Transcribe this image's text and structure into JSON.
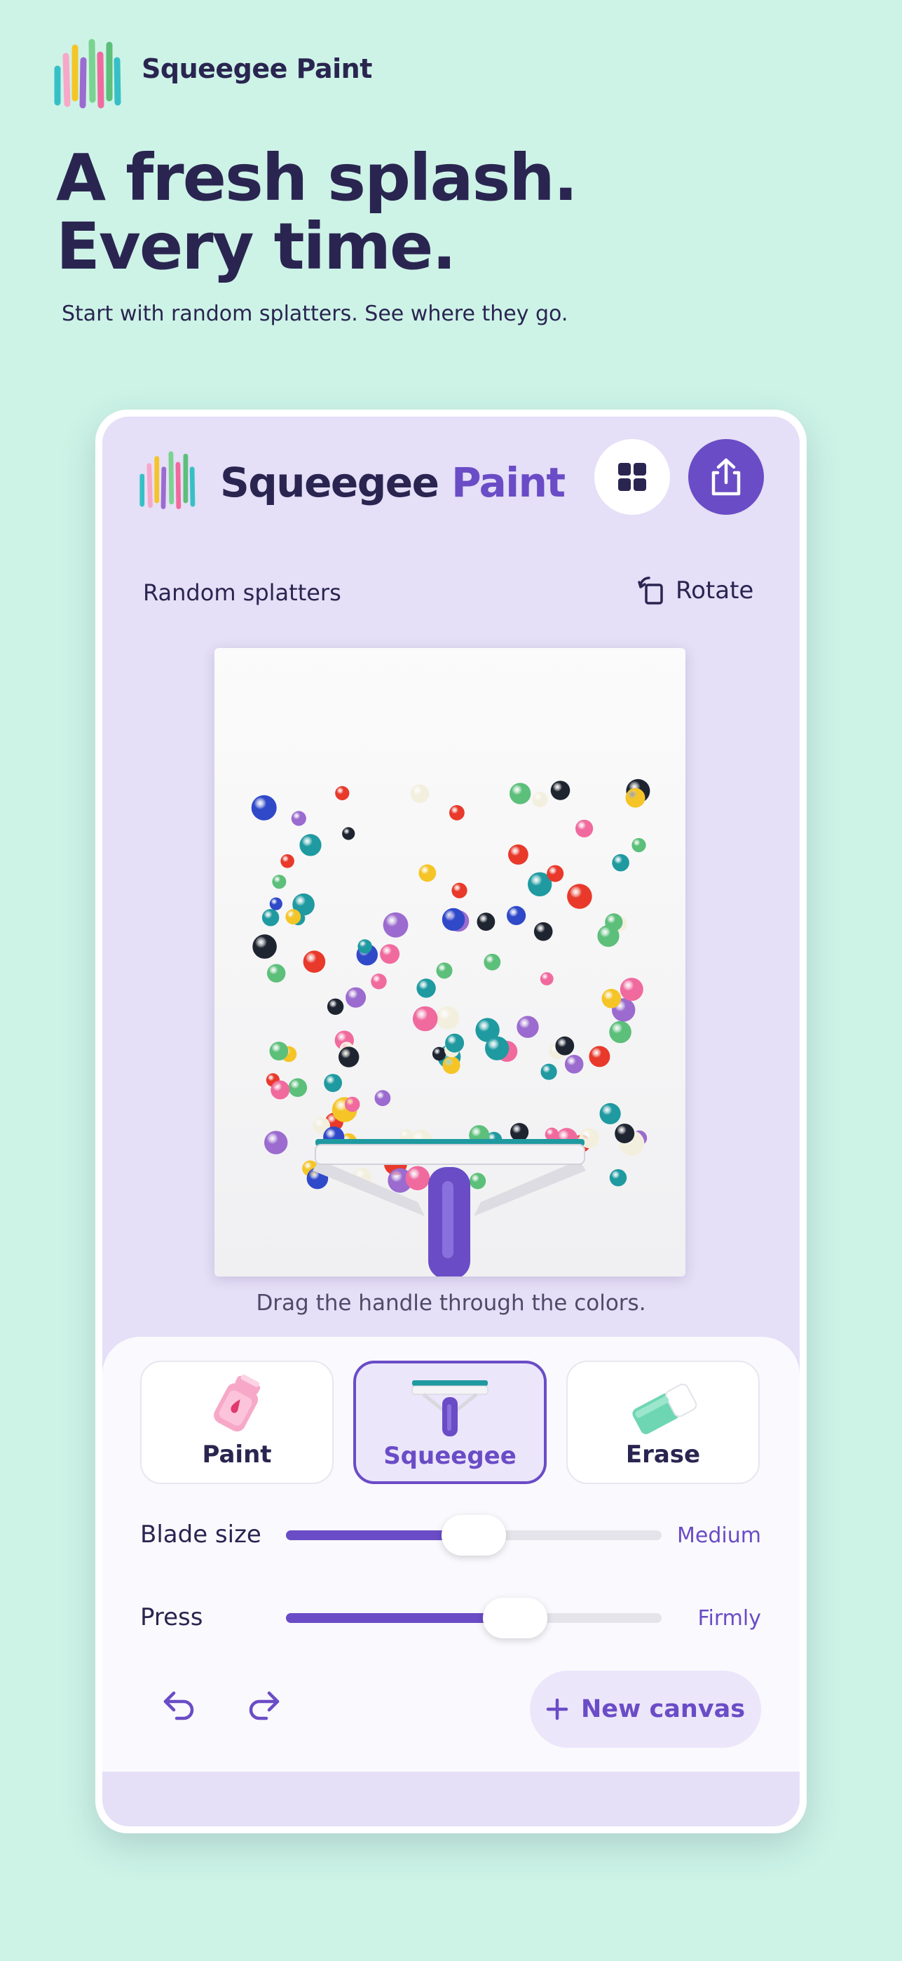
{
  "header": {
    "brand": "Squeegee Paint"
  },
  "hero": {
    "line1": "A fresh splash.",
    "line2": "Every time.",
    "subtitle": "Start with random splatters. See where they go."
  },
  "app": {
    "title_part1": "Squeegee",
    "title_part2": "Paint",
    "gallery_icon": "grid-icon",
    "share_icon": "share-icon",
    "section_label": "Random splatters",
    "rotate_label": "Rotate",
    "hint": "Drag the handle through the colors.",
    "tools": [
      {
        "label": "Paint",
        "icon": "paint-bottle-icon",
        "selected": false
      },
      {
        "label": "Squeegee",
        "icon": "squeegee-icon",
        "selected": true
      },
      {
        "label": "Erase",
        "icon": "eraser-icon",
        "selected": false
      }
    ],
    "blade_size": {
      "label": "Blade size",
      "value": "Medium",
      "level": 0.5
    },
    "press": {
      "label": "Press",
      "value": "Firmly",
      "level": 0.61
    },
    "undo_icon": "undo-icon",
    "redo_icon": "redo-icon",
    "new_canvas_label": "New canvas",
    "colors": {
      "accent": "#6a4cc6",
      "background": "#cdf3e7",
      "screen": "#e5dff7",
      "splatters": [
        "#e8392b",
        "#f06a9e",
        "#f5c527",
        "#2f49c9",
        "#1e9aa0",
        "#5cbf7a",
        "#9b6bcf",
        "#1e2430",
        "#f3efde"
      ]
    }
  }
}
